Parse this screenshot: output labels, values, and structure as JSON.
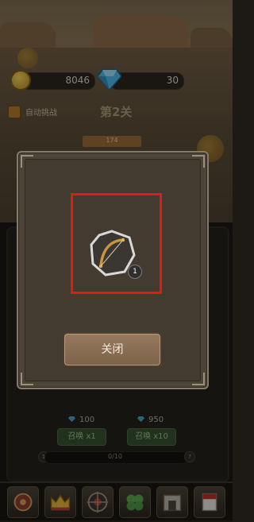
{
  "resources": {
    "coins": "8046",
    "gems": "30"
  },
  "stage": {
    "auto_battle_label": "自动挑战",
    "title": "第2关",
    "progress_label": "174"
  },
  "summon": {
    "single_cost": "100",
    "multi_cost": "950",
    "single_label": "召唤 x1",
    "multi_label": "召唤 x10",
    "progress_text": "0/10",
    "left_badge": "1",
    "right_badge": "?"
  },
  "reward_modal": {
    "item_icon": "bow-icon",
    "item_count": "1",
    "close_label": "关闭"
  },
  "tabs": [
    {
      "name": "shield-tab",
      "icon": "round-shield-icon"
    },
    {
      "name": "crown-tab",
      "icon": "crown-icon"
    },
    {
      "name": "wheel-tab",
      "icon": "compass-wheel-icon"
    },
    {
      "name": "clover-tab",
      "icon": "clover-icon"
    },
    {
      "name": "gate-tab",
      "icon": "gate-icon"
    },
    {
      "name": "banner-tab",
      "icon": "banner-icon"
    }
  ],
  "colors": {
    "highlight": "#e21b12",
    "modal_bg": "#4c4438",
    "button": "#8a6e54"
  }
}
